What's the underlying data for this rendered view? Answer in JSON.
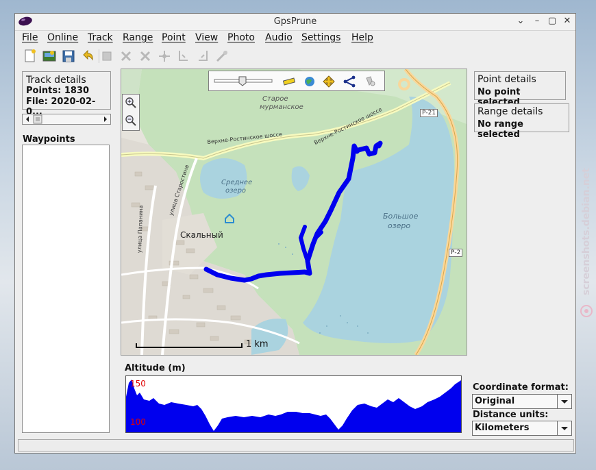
{
  "window": {
    "title": "GpsPrune"
  },
  "menu": [
    "File",
    "Online",
    "Track",
    "Range",
    "Point",
    "View",
    "Photo",
    "Audio",
    "Settings",
    "Help"
  ],
  "track_details": {
    "title": "Track details",
    "points": "Points: 1830",
    "file": "File: 2020-02-0..."
  },
  "waypoints": {
    "label": "Waypoints"
  },
  "point_details": {
    "title": "Point details",
    "status": "No point selected"
  },
  "range_details": {
    "title": "Range details",
    "status": "No range selected"
  },
  "coordinate_format": {
    "label": "Coordinate format:",
    "value": "Original"
  },
  "distance_units": {
    "label": "Distance units:",
    "value": "Kilometers"
  },
  "altitude": {
    "title": "Altitude (m)",
    "max_label": "150",
    "min_label": "100"
  },
  "map": {
    "scale": "1 km",
    "labels": {
      "staroe": "Старое",
      "murmanskoe": "мурманское",
      "srednee": "Среднее",
      "ozero1": "озеро",
      "bolshoe": "Большое",
      "ozero2": "озеро",
      "skalny": "Скальный",
      "road1": "Верхне-Ростинское шоссе",
      "road2": "Верхне-Ростинское шоссе",
      "r21": "Р-21",
      "r2": "Р-2",
      "street1": "улица Старостина",
      "street2": "улица Папанина"
    },
    "track_color": "#0000ee"
  },
  "watermark": "screenshots.debian.net"
}
